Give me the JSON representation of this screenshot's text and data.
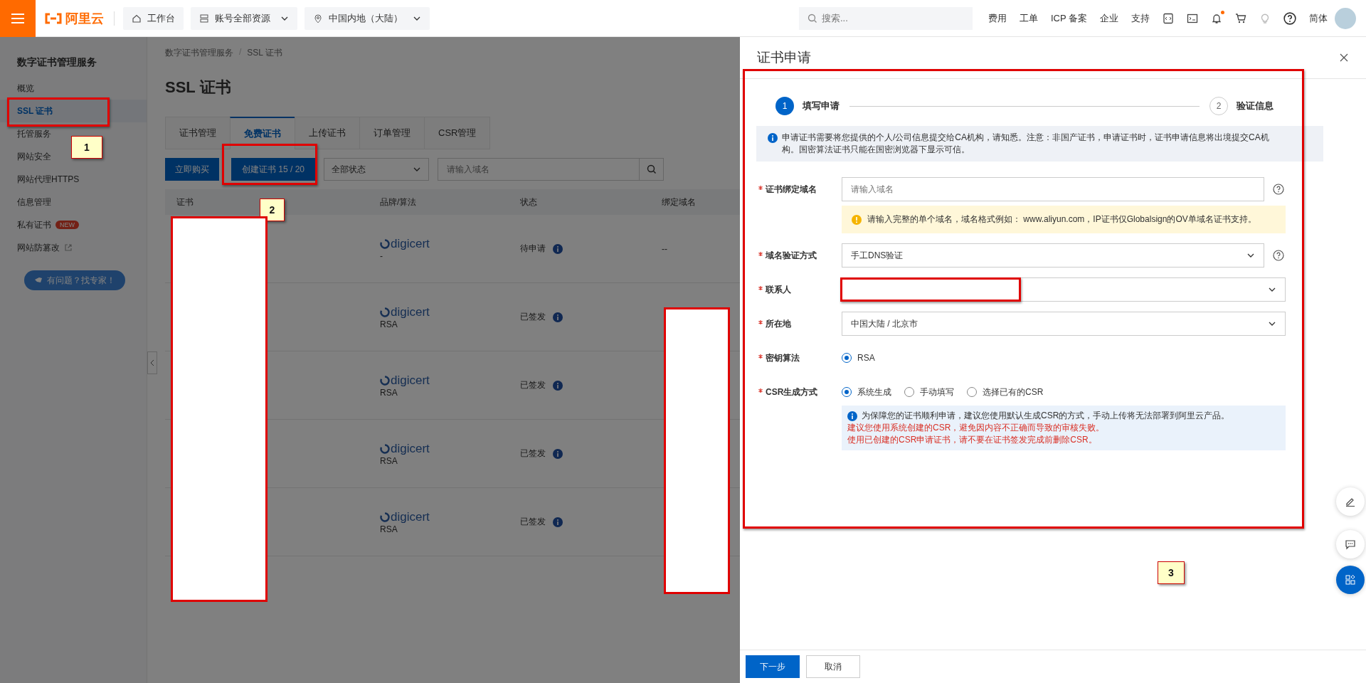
{
  "topbar": {
    "logo": "阿里云",
    "nav": [
      {
        "label": "工作台",
        "dropdown": false
      },
      {
        "label": "账号全部资源",
        "dropdown": true
      },
      {
        "label": "中国内地（大陆）",
        "dropdown": true
      }
    ],
    "search": {
      "placeholder": "搜索..."
    },
    "links": [
      "费用",
      "工单",
      "ICP 备案",
      "企业",
      "支持"
    ],
    "notification_dot": true,
    "language": "简体"
  },
  "sidebar": {
    "title": "数字证书管理服务",
    "items": [
      {
        "label": "概览",
        "selected": false,
        "external": false
      },
      {
        "label": "SSL 证书",
        "selected": true,
        "external": false
      },
      {
        "label": "托管服务",
        "selected": false,
        "external": false
      },
      {
        "label": "网站安全",
        "selected": false,
        "external": false
      },
      {
        "label": "网站代理HTTPS",
        "selected": false,
        "external": false
      },
      {
        "label": "信息管理",
        "selected": false,
        "external": false
      },
      {
        "label": "私有证书",
        "selected": false,
        "badge": "NEW",
        "external": false
      },
      {
        "label": "网站防篡改",
        "selected": false,
        "external": true
      }
    ],
    "help_button": "有问题？找专家！"
  },
  "page": {
    "breadcrumb": [
      "数字证书管理服务",
      "SSL 证书"
    ],
    "breadcrumb_separator": "/",
    "title": "SSL 证书",
    "tabs": [
      {
        "label": "证书管理",
        "selected": false
      },
      {
        "label": "免费证书",
        "selected": true
      },
      {
        "label": "上传证书",
        "selected": false
      },
      {
        "label": "订单管理",
        "selected": false
      },
      {
        "label": "CSR管理",
        "selected": false
      }
    ],
    "buy_button": "立即购买",
    "create_button": "创建证书 15 / 20",
    "status_filter": "全部状态",
    "domain_search": {
      "placeholder": "请输入域名"
    },
    "table": {
      "columns": [
        "证书",
        "品牌/算法",
        "状态",
        "绑定域名"
      ],
      "rows": [
        {
          "brand": "digicert",
          "algorithm": "-",
          "status": "待申请",
          "domain": "--"
        },
        {
          "brand": "digicert",
          "algorithm": "RSA",
          "status": "已签发"
        },
        {
          "brand": "digicert",
          "algorithm": "RSA",
          "status": "已签发"
        },
        {
          "brand": "digicert",
          "algorithm": "RSA",
          "status": "已签发"
        },
        {
          "brand": "digicert",
          "algorithm": "RSA",
          "status": "已签发"
        }
      ]
    }
  },
  "drawer": {
    "title": "证书申请",
    "steps": [
      {
        "number": "1",
        "label": "填写申请",
        "selected": true
      },
      {
        "number": "2",
        "label": "验证信息",
        "selected": false
      }
    ],
    "notice": "申请证书需要将您提供的个人/公司信息提交给CA机构，请知悉。注意：非国产证书，申请证书时，证书申请信息将出境提交CA机构。国密算法证书只能在国密浏览器下显示可信。",
    "fields": [
      {
        "kind": "input",
        "label": "证书绑定域名",
        "required": true,
        "placeholder": "请输入域名",
        "help": true,
        "hint": "请输入完整的单个域名，域名格式例如： www.aliyun.com，IP证书仅Globalsign的OV单域名证书支持。"
      },
      {
        "kind": "select",
        "label": "域名验证方式",
        "required": true,
        "value": "手工DNS验证",
        "help": true
      },
      {
        "kind": "select",
        "label": "联系人",
        "required": true,
        "redacted": true,
        "help": false
      },
      {
        "kind": "select",
        "label": "所在地",
        "required": true,
        "value": "中国大陆 / 北京市",
        "help": false
      },
      {
        "kind": "radio",
        "label": "密钥算法",
        "required": true,
        "options": [
          {
            "label": "RSA",
            "selected": true
          }
        ]
      },
      {
        "kind": "radio",
        "label": "CSR生成方式",
        "required": true,
        "options": [
          {
            "label": "系统生成",
            "selected": true
          },
          {
            "label": "手动填写",
            "selected": false
          },
          {
            "label": "选择已有的CSR",
            "selected": false
          }
        ],
        "note": "为保障您的证书顺利申请，建议您使用默认生成CSR的方式，手动上传将无法部署到阿里云产品。",
        "warnings": [
          "建议您使用系统创建的CSR，避免因内容不正确而导致的审核失败。",
          "使用已创建的CSR申请证书，请不要在证书签发完成前删除CSR。"
        ]
      }
    ],
    "next_button": "下一步",
    "cancel_button": "取消"
  },
  "annotations": [
    {
      "kind": "highlight"
    },
    {
      "kind": "callout",
      "number": "1"
    },
    {
      "kind": "highlight"
    },
    {
      "kind": "callout",
      "number": "2"
    },
    {
      "kind": "redaction"
    },
    {
      "kind": "redaction"
    },
    {
      "kind": "highlight"
    },
    {
      "kind": "callout",
      "number": "3"
    }
  ]
}
